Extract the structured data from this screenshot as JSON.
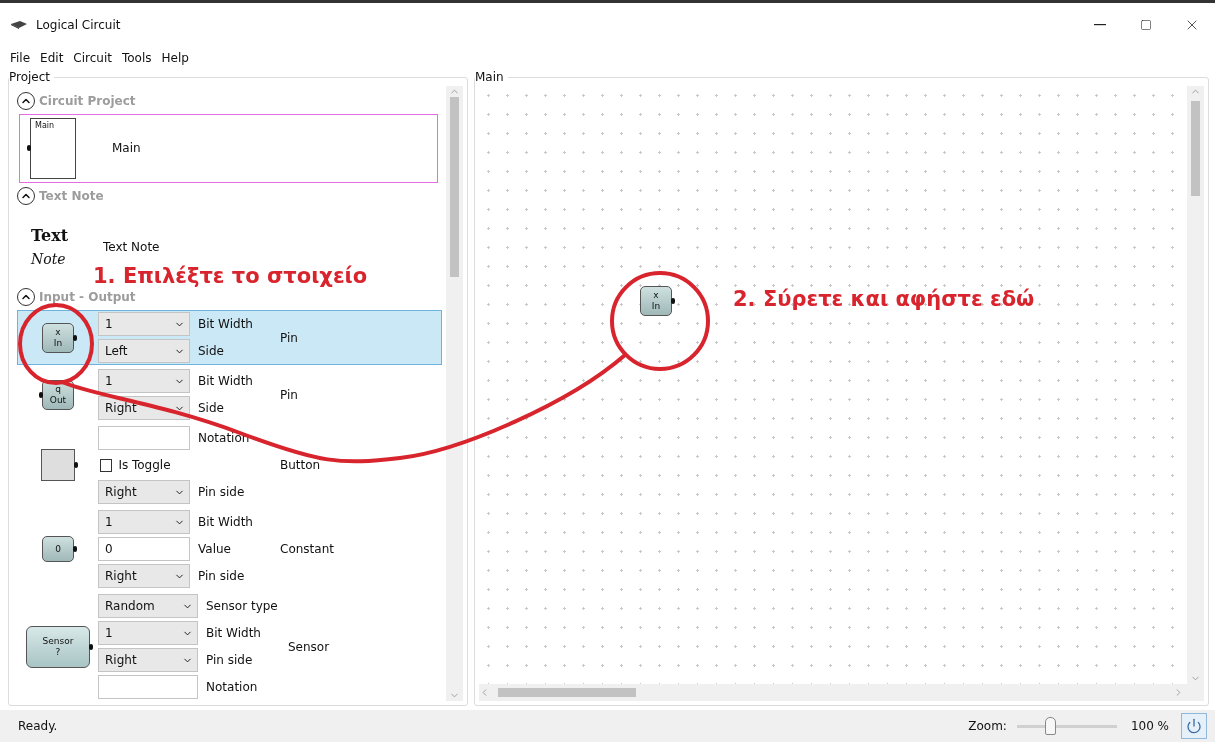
{
  "window": {
    "title": "Logical Circuit"
  },
  "menu": [
    "File",
    "Edit",
    "Circuit",
    "Tools",
    "Help"
  ],
  "project": {
    "title": "Project",
    "sections": [
      {
        "title": "Circuit Project",
        "expanded": true,
        "items": [
          {
            "kind": "circuit",
            "symbol": [
              "Main"
            ],
            "name": "Main",
            "current": true
          }
        ]
      },
      {
        "title": "Text Note",
        "expanded": true,
        "items": [
          {
            "kind": "note",
            "symbol": [
              "Text",
              "Note"
            ],
            "name": "Text Note"
          }
        ]
      },
      {
        "title": "Input - Output",
        "expanded": true,
        "items": [
          {
            "kind": "input_pin",
            "symbol": [
              "x",
              "In"
            ],
            "name": "Pin",
            "selected": true,
            "fields": [
              {
                "kind": "select",
                "value": "1",
                "label": "Bit Width"
              },
              {
                "kind": "select",
                "value": "Left",
                "label": "Side"
              }
            ]
          },
          {
            "kind": "output_pin",
            "symbol": [
              "q",
              "Out"
            ],
            "name": "Pin",
            "selected": false,
            "fields": [
              {
                "kind": "select",
                "value": "1",
                "label": "Bit Width"
              },
              {
                "kind": "select",
                "value": "Right",
                "label": "Side"
              }
            ]
          },
          {
            "kind": "button",
            "name": "Button",
            "selected": false,
            "fields": [
              {
                "kind": "text",
                "label": "Notation"
              },
              {
                "kind": "checkbox",
                "caption": "Is Toggle",
                "checked": false
              },
              {
                "kind": "select",
                "value": "Right",
                "label": "Pin side"
              }
            ]
          },
          {
            "kind": "constant",
            "symbol": [
              "0"
            ],
            "name": "Constant",
            "selected": false,
            "fields": [
              {
                "kind": "select",
                "value": "1",
                "label": "Bit Width"
              },
              {
                "kind": "text",
                "value": "0",
                "label": "Value"
              },
              {
                "kind": "select",
                "value": "Right",
                "label": "Pin side"
              }
            ]
          },
          {
            "kind": "sensor",
            "symbol": [
              "Sensor",
              "?"
            ],
            "name": "Sensor",
            "selected": false,
            "fields": [
              {
                "kind": "select",
                "value": "Random",
                "label": "Sensor type"
              },
              {
                "kind": "select",
                "value": "1",
                "label": "Bit Width"
              },
              {
                "kind": "select",
                "value": "Right",
                "label": "Pin side"
              },
              {
                "kind": "text",
                "label": "Notation"
              }
            ]
          }
        ]
      }
    ]
  },
  "canvas": {
    "title": "Main",
    "nodes": [
      {
        "kind": "input_pin",
        "symbol": [
          "x",
          "In"
        ]
      }
    ]
  },
  "annotations": [
    {
      "text": "1. Επιλέξτε το στοιχείο"
    },
    {
      "text": "2. Σύρετε και αφήστε εδώ"
    }
  ],
  "status_bar": {
    "text": "Ready.",
    "zoom_label": "Zoom:",
    "zoom": {
      "level": 0.33
    },
    "zoom_value": "100 %"
  }
}
